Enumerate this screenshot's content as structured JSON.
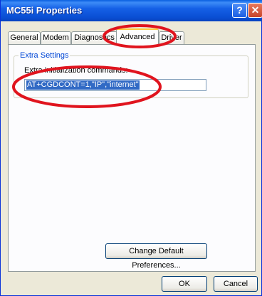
{
  "window": {
    "title": "MC55i Properties",
    "help_symbol": "?",
    "close_symbol": "✕"
  },
  "tabs": [
    {
      "label": "General"
    },
    {
      "label": "Modem"
    },
    {
      "label": "Diagnostics"
    },
    {
      "label": "Advanced"
    },
    {
      "label": "Driver"
    }
  ],
  "active_tab": "Advanced",
  "extra_settings": {
    "group_label": "Extra Settings",
    "field_label": "Extra initialization commands:",
    "value": "AT+CGDCONT=1,\"IP\",\"internet\""
  },
  "buttons": {
    "change_defaults": "Change Default Preferences...",
    "ok": "OK",
    "cancel": "Cancel"
  },
  "colors": {
    "annotation": "#e0141e",
    "titlebar": "#0a5fe0",
    "selection": "#316ac5",
    "group_label": "#0046d5"
  }
}
